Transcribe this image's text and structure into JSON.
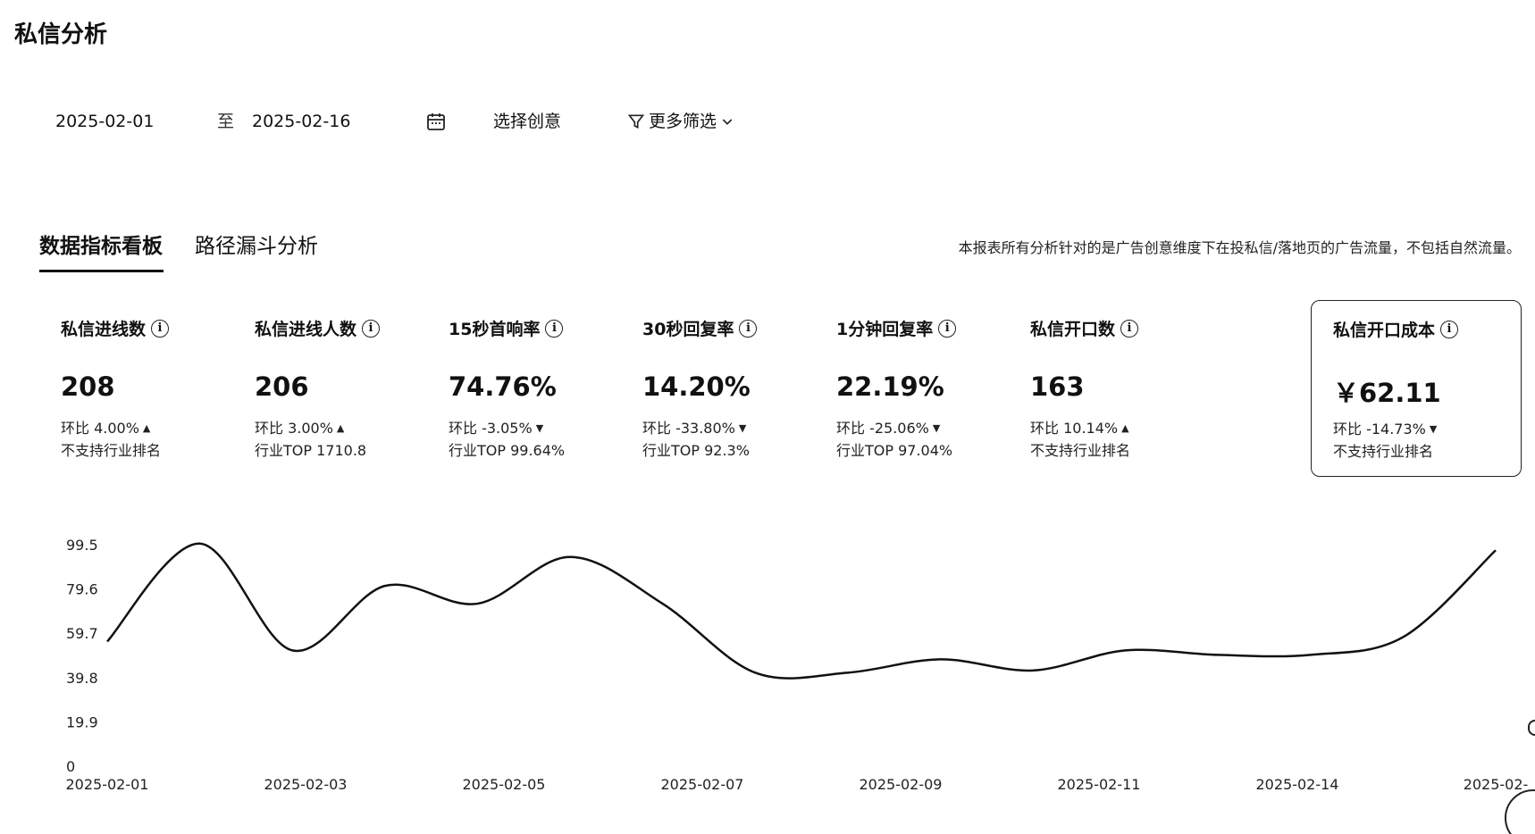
{
  "page": {
    "title": "私信分析"
  },
  "filters": {
    "date_start": "2025-02-01",
    "date_separator": "至",
    "date_end": "2025-02-16",
    "creative_placeholder": "选择创意",
    "more_filters_label": "更多筛选"
  },
  "tabs": [
    {
      "label": "数据指标看板",
      "active": true
    },
    {
      "label": "路径漏斗分析",
      "active": false
    }
  ],
  "report_note": "本报表所有分析针对的是广告创意维度下在投私信/落地页的广告流量，不包括自然流量。",
  "metrics": [
    {
      "label": "私信进线数",
      "value": "208",
      "change": "环比 4.00%",
      "direction": "up",
      "rank": "不支持行业排名"
    },
    {
      "label": "私信进线人数",
      "value": "206",
      "change": "环比 3.00%",
      "direction": "up",
      "rank": "行业TOP 1710.8"
    },
    {
      "label": "15秒首响率",
      "value": "74.76%",
      "change": "环比 -3.05%",
      "direction": "down",
      "rank": "行业TOP 99.64%"
    },
    {
      "label": "30秒回复率",
      "value": "14.20%",
      "change": "环比 -33.80%",
      "direction": "down",
      "rank": "行业TOP 92.3%"
    },
    {
      "label": "1分钟回复率",
      "value": "22.19%",
      "change": "环比 -25.06%",
      "direction": "down",
      "rank": "行业TOP 97.04%"
    },
    {
      "label": "私信开口数",
      "value": "163",
      "change": "环比 10.14%",
      "direction": "up",
      "rank": "不支持行业排名"
    },
    {
      "label": "私信开口成本",
      "value": "￥62.11",
      "change": "环比 -14.73%",
      "direction": "down",
      "rank": "不支持行业排名",
      "selected": true
    }
  ],
  "chart_data": {
    "type": "line",
    "title": "",
    "xlabel": "",
    "ylabel": "",
    "y_ticks": [
      "99.5",
      "79.6",
      "59.7",
      "39.8",
      "19.9",
      "0"
    ],
    "ylim": [
      0,
      99.5
    ],
    "x_tick_labels": [
      "2025-02-01",
      "2025-02-03",
      "2025-02-05",
      "2025-02-07",
      "2025-02-09",
      "2025-02-11",
      "2025-02-14",
      "2025-02-"
    ],
    "x": [
      "2025-02-01",
      "2025-02-02",
      "2025-02-03",
      "2025-02-04",
      "2025-02-05",
      "2025-02-06",
      "2025-02-07",
      "2025-02-08",
      "2025-02-09",
      "2025-02-10",
      "2025-02-11",
      "2025-02-12",
      "2025-02-13",
      "2025-02-14",
      "2025-02-15",
      "2025-02-16"
    ],
    "series": [
      {
        "values": [
          56,
          100,
          52,
          81,
          73,
          94,
          73,
          42,
          42,
          48,
          43,
          52,
          50,
          50,
          58,
          97
        ]
      }
    ],
    "grid": false,
    "line_color": "#111111"
  }
}
